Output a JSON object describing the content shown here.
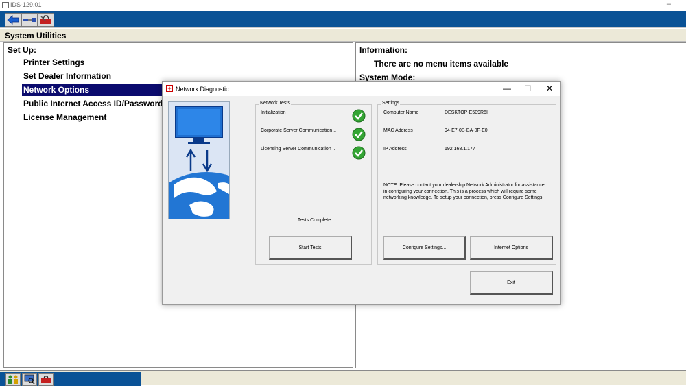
{
  "window": {
    "title": "IDS-129.01",
    "minimize": "–"
  },
  "toolbar": {
    "icons": [
      "back-arrow-icon",
      "connector-icon",
      "toolbox-icon"
    ]
  },
  "header": {
    "title": "System Utilities"
  },
  "left_pane": {
    "title": "Set Up:",
    "items": [
      "Printer Settings",
      "Set Dealer Information",
      "Network Options",
      "Public Internet Access ID/Password cor",
      "License Management"
    ],
    "selected_index": 2
  },
  "right_pane": {
    "info_title": "Information:",
    "info_text": "There are no menu items available",
    "mode_title": "System Mode:"
  },
  "dialog": {
    "title": "Network Diagnostic",
    "controls": {
      "minimize": "—",
      "maximize": "☐",
      "close": "✕"
    },
    "network_tests": {
      "label": "Network Tests",
      "tests": [
        {
          "name": "Initialization",
          "status": "passed"
        },
        {
          "name": "Corporate Server Communication ..",
          "status": "passed"
        },
        {
          "name": "Licensing Server Communication ..",
          "status": "passed"
        }
      ],
      "status_text": "Tests Complete",
      "start_button": "Start Tests"
    },
    "settings": {
      "label": "Settings",
      "rows": [
        {
          "label": "Computer Name",
          "value": "DESKTOP-E509R6I"
        },
        {
          "label": "MAC Address",
          "value": "94-E7-0B-BA-0F-E0"
        },
        {
          "label": "IP Address",
          "value": "192.168.1.177"
        }
      ],
      "note": "NOTE: Please contact your dealership Network Administrator for assistance in configuring your connection. This is a process which will require some networking knowledge. To setup your connection, press Configure Settings.",
      "configure_button": "Configure Settings...",
      "internet_button": "Internet Options"
    },
    "exit_button": "Exit"
  },
  "status_bar": {
    "icons": [
      "people-icon",
      "computer-search-icon",
      "toolbox-icon"
    ]
  },
  "colors": {
    "toolbar_blue": "#0a5296",
    "selection": "#0b0b6e",
    "check_green": "#2e9e2e"
  }
}
